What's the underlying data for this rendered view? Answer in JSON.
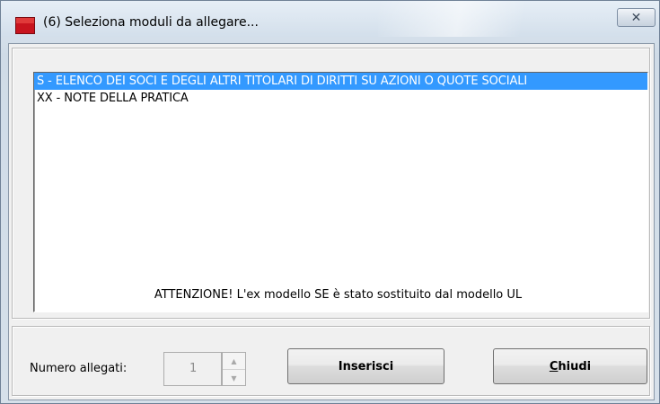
{
  "window": {
    "title": "(6) Seleziona moduli da allegare...",
    "close_glyph": "✕"
  },
  "list": {
    "items": [
      {
        "label": "S - ELENCO DEI SOCI E DEGLI ALTRI TITOLARI DI DIRITTI SU AZIONI O QUOTE SOCIALI",
        "selected": true
      },
      {
        "label": "XX - NOTE DELLA PRATICA",
        "selected": false
      }
    ]
  },
  "notice": "ATTENZIONE! L'ex modello SE è stato sostituito dal modello UL",
  "attachments": {
    "label": "Numero allegati:",
    "value": "1"
  },
  "buttons": {
    "insert_label": "Inserisci",
    "close_mnemonic": "C",
    "close_rest": "hiudi"
  },
  "colors": {
    "selection": "#3399ff",
    "app_icon": "#c8141e"
  },
  "icons": {
    "app": "foto-app-icon",
    "close": "close-icon",
    "spin_up": "spin-up-arrow-icon",
    "spin_down": "spin-down-arrow-icon"
  }
}
